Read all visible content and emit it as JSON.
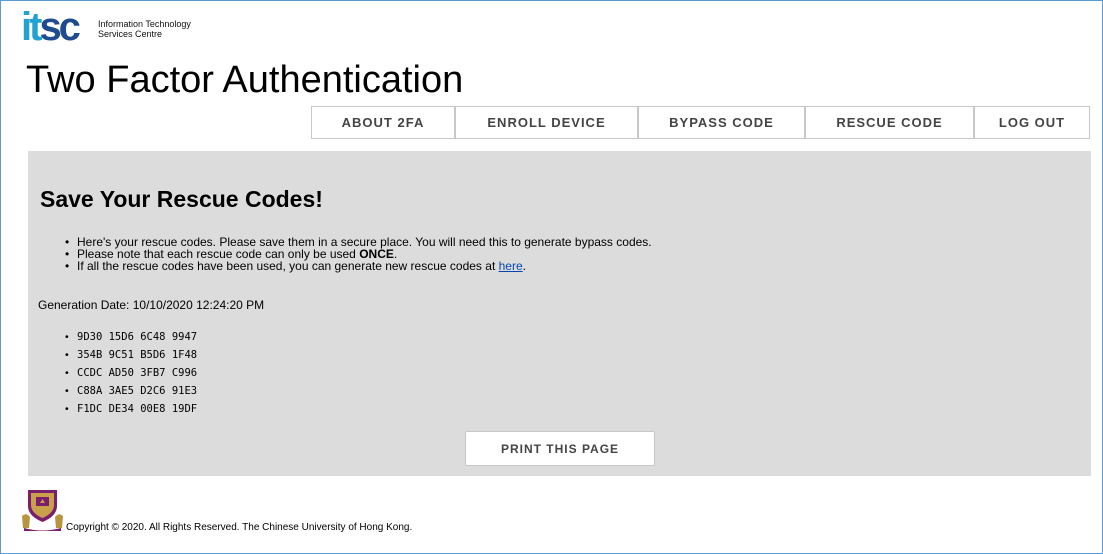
{
  "logo": {
    "text_i": "it",
    "text_sc": "sc",
    "line1": "Information Technology",
    "line2": "Services Centre"
  },
  "page_title": "Two Factor Authentication",
  "nav": {
    "about": "ABOUT 2FA",
    "enroll": "ENROLL DEVICE",
    "bypass": "BYPASS CODE",
    "rescue": "RESCUE CODE",
    "logout": "LOG OUT"
  },
  "main": {
    "heading": "Save Your Rescue Codes!",
    "bullet1": "Here's your rescue codes. Please save them in a secure place. You will need this to generate bypass codes.",
    "bullet2_prefix": "Please note that each rescue code can only be used ",
    "bullet2_bold": "ONCE",
    "bullet2_suffix": ".",
    "bullet3_prefix": "If all the rescue codes have been used, you can generate new rescue codes at ",
    "bullet3_link": "here",
    "bullet3_suffix": ".",
    "generation_date": "Generation Date: 10/10/2020 12:24:20 PM",
    "codes": [
      "9D30 15D6 6C48 9947",
      "354B 9C51 B5D6 1F48",
      "CCDC AD50 3FB7 C996",
      "C88A 3AE5 D2C6 91E3",
      "F1DC DE34 00E8 19DF"
    ],
    "print_label": "PRINT THIS PAGE"
  },
  "footer": {
    "copyright": "Copyright © 2020. All Rights Reserved. The Chinese University of Hong Kong."
  },
  "icons": {
    "seal": "cuhk-seal-icon"
  }
}
